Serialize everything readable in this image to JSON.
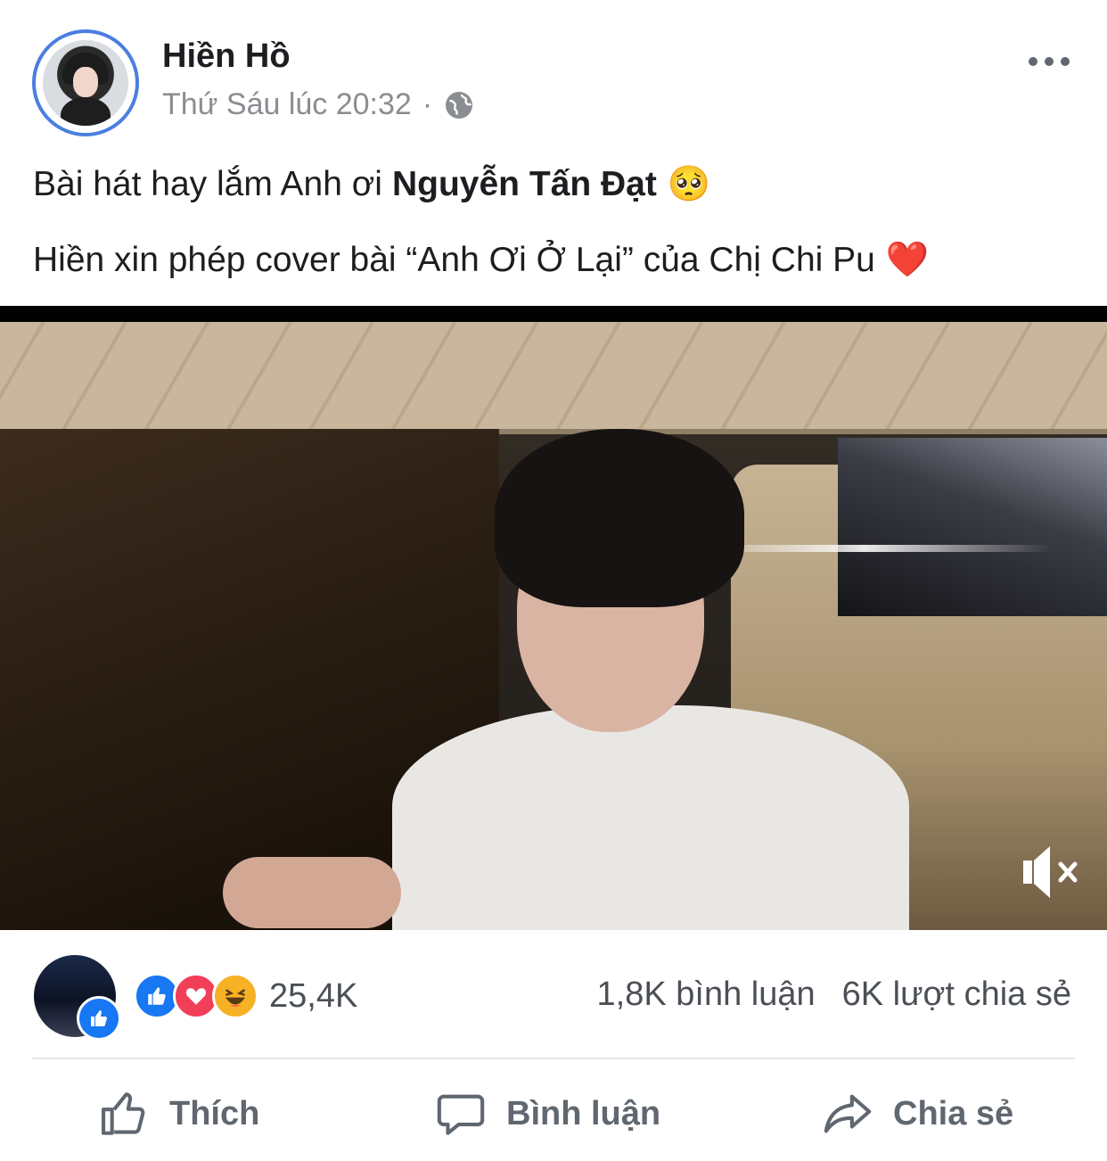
{
  "post": {
    "author_name": "Hiền Hồ",
    "timestamp": "Thứ Sáu lúc 20:32",
    "separator": "·",
    "text_line1_prefix": "Bài hát hay lắm Anh ơi",
    "text_line1_mention": "Nguyễn Tấn Đạt",
    "text_line1_emoji": "🥺",
    "text_line2": "Hiền xin phép cover bài “Anh Ơi Ở Lại” của Chị Chi Pu",
    "text_line2_emoji": "❤️"
  },
  "video": {
    "muted": true,
    "mute_icon": "volume-muted-icon"
  },
  "engagement": {
    "reactions_total": "25,4K",
    "reaction_types": [
      "like",
      "love",
      "haha"
    ],
    "comments": "1,8K bình luận",
    "shares": "6K lượt chia sẻ"
  },
  "actions": {
    "like_label": "Thích",
    "comment_label": "Bình luận",
    "share_label": "Chia sẻ"
  },
  "colors": {
    "accent": "#1877f2",
    "love": "#f33e58",
    "haha": "#f7b125",
    "muted_text": "#8a8d91"
  }
}
